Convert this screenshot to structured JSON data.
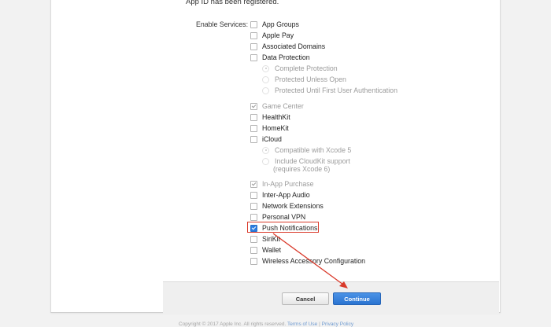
{
  "header": {
    "registered_text": "App ID has been registered."
  },
  "services": {
    "label": "Enable Services:",
    "items": [
      {
        "label": "App Groups",
        "state": "unchecked"
      },
      {
        "label": "Apple Pay",
        "state": "unchecked"
      },
      {
        "label": "Associated Domains",
        "state": "unchecked"
      },
      {
        "label": "Data Protection",
        "state": "unchecked"
      },
      {
        "label": "Complete Protection",
        "state": "radio-disabled"
      },
      {
        "label": "Protected Unless Open",
        "state": "radio-disabled"
      },
      {
        "label": "Protected Until First User Authentication",
        "state": "radio-disabled"
      },
      {
        "label": "Game Center",
        "state": "checked-disabled"
      },
      {
        "label": "HealthKit",
        "state": "unchecked"
      },
      {
        "label": "HomeKit",
        "state": "unchecked"
      },
      {
        "label": "iCloud",
        "state": "unchecked"
      },
      {
        "label": "Compatible with Xcode 5",
        "state": "radio-disabled"
      },
      {
        "label": "Include CloudKit support",
        "extra": "(requires Xcode 6)",
        "state": "radio-disabled"
      },
      {
        "label": "In-App Purchase",
        "state": "checked-disabled"
      },
      {
        "label": "Inter-App Audio",
        "state": "unchecked"
      },
      {
        "label": "Network Extensions",
        "state": "unchecked"
      },
      {
        "label": "Personal VPN",
        "state": "unchecked"
      },
      {
        "label": "Push Notifications",
        "state": "checked"
      },
      {
        "label": "SiriKit",
        "state": "unchecked"
      },
      {
        "label": "Wallet",
        "state": "unchecked"
      },
      {
        "label": "Wireless Accessory Configuration",
        "state": "unchecked"
      }
    ]
  },
  "footer": {
    "cancel_label": "Cancel",
    "continue_label": "Continue"
  },
  "copyright": {
    "text": "Copyright © 2017 Apple Inc. All rights reserved.",
    "terms": "Terms of Use",
    "privacy": "Privacy Policy"
  },
  "colors": {
    "accent": "#2b7ce0",
    "annotation": "#d93a2b"
  }
}
